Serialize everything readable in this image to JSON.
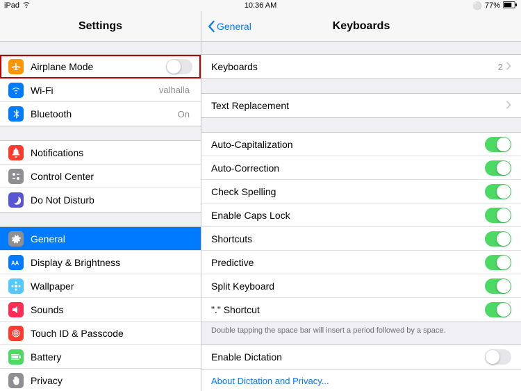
{
  "status": {
    "device": "iPad",
    "time": "10:36 AM",
    "battery": "77%"
  },
  "sidebar": {
    "title": "Settings",
    "g1": [
      {
        "label": "Airplane Mode",
        "icon": "airplane",
        "bg": "#ff9500",
        "toggle": false,
        "highlight": true
      },
      {
        "label": "Wi-Fi",
        "icon": "wifi",
        "bg": "#007aff",
        "value": "valhalla"
      },
      {
        "label": "Bluetooth",
        "icon": "bluetooth",
        "bg": "#007aff",
        "value": "On"
      }
    ],
    "g2": [
      {
        "label": "Notifications",
        "icon": "bell",
        "bg": "#ff3b30"
      },
      {
        "label": "Control Center",
        "icon": "control",
        "bg": "#8e8e93"
      },
      {
        "label": "Do Not Disturb",
        "icon": "moon",
        "bg": "#5856d6"
      }
    ],
    "g3": [
      {
        "label": "General",
        "icon": "gear",
        "bg": "#8e8e93",
        "selected": true
      },
      {
        "label": "Display & Brightness",
        "icon": "aa",
        "bg": "#007aff"
      },
      {
        "label": "Wallpaper",
        "icon": "flower",
        "bg": "#54c7fc"
      },
      {
        "label": "Sounds",
        "icon": "speaker",
        "bg": "#ff2d55"
      },
      {
        "label": "Touch ID & Passcode",
        "icon": "finger",
        "bg": "#ff3b30"
      },
      {
        "label": "Battery",
        "icon": "battery",
        "bg": "#4cd964"
      },
      {
        "label": "Privacy",
        "icon": "hand",
        "bg": "#8e8e93"
      }
    ]
  },
  "detail": {
    "back": "General",
    "title": "Keyboards",
    "g1": [
      {
        "label": "Keyboards",
        "value": "2",
        "chevron": true
      }
    ],
    "g2": [
      {
        "label": "Text Replacement",
        "chevron": true
      }
    ],
    "g3": [
      {
        "label": "Auto-Capitalization",
        "toggle": true
      },
      {
        "label": "Auto-Correction",
        "toggle": true
      },
      {
        "label": "Check Spelling",
        "toggle": true
      },
      {
        "label": "Enable Caps Lock",
        "toggle": true
      },
      {
        "label": "Shortcuts",
        "toggle": true
      },
      {
        "label": "Predictive",
        "toggle": true
      },
      {
        "label": "Split Keyboard",
        "toggle": true
      },
      {
        "label": "\".\" Shortcut",
        "toggle": true
      }
    ],
    "footer": "Double tapping the space bar will insert a period followed by a space.",
    "g4": [
      {
        "label": "Enable Dictation",
        "toggle": false
      }
    ],
    "link": "About Dictation and Privacy..."
  }
}
